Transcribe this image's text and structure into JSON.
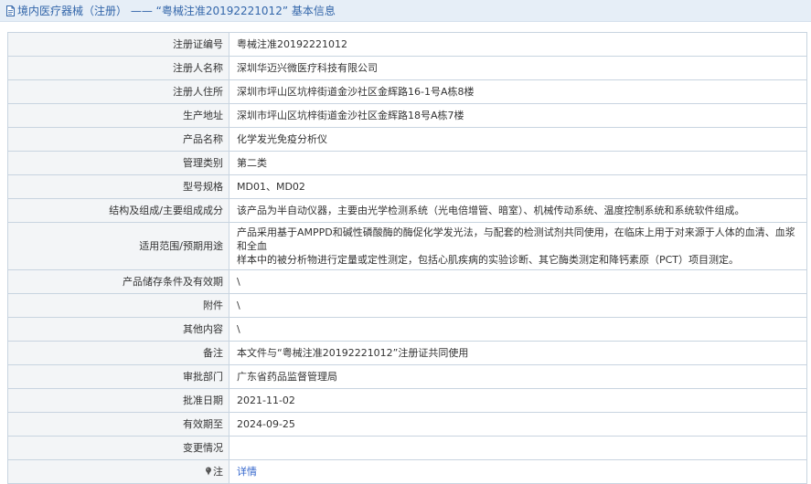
{
  "header": {
    "title": "境内医疗器械（注册） —— “粤械注准20192221012” 基本信息",
    "icon": "document-icon"
  },
  "rows": {
    "reg_no": {
      "label": "注册证编号",
      "value": "粤械注准20192221012"
    },
    "registrant": {
      "label": "注册人名称",
      "value": "深圳华迈兴微医疗科技有限公司"
    },
    "registrant_addr": {
      "label": "注册人住所",
      "value": "深圳市坪山区坑梓街道金沙社区金辉路16-1号A栋8楼"
    },
    "production_addr": {
      "label": "生产地址",
      "value": "深圳市坪山区坑梓街道金沙社区金辉路18号A栋7楼"
    },
    "product_name": {
      "label": "产品名称",
      "value": "化学发光免疫分析仪"
    },
    "category": {
      "label": "管理类别",
      "value": "第二类"
    },
    "model": {
      "label": "型号规格",
      "value": "MD01、MD02"
    },
    "structure": {
      "label": "结构及组成/主要组成成分",
      "value": "该产品为半自动仪器，主要由光学检测系统（光电倍增管、暗室）、机械传动系统、温度控制系统和系统软件组成。"
    },
    "scope": {
      "label": "适用范围/预期用途",
      "value_line1": "产品采用基于AMPPD和碱性磷酸酶的酶促化学发光法，与配套的检测试剂共同使用，在临床上用于对来源于人体的血清、血浆和全血",
      "value_line2": "样本中的被分析物进行定量或定性测定，包括心肌疾病的实验诊断、其它酶类测定和降钙素原（PCT）项目测定。"
    },
    "storage": {
      "label": "产品储存条件及有效期",
      "value": "\\"
    },
    "attachment": {
      "label": "附件",
      "value": "\\"
    },
    "other": {
      "label": "其他内容",
      "value": "\\"
    },
    "remark": {
      "label": "备注",
      "value": "本文件与“粤械注准20192221012”注册证共同使用"
    },
    "authority": {
      "label": "审批部门",
      "value": "广东省药品监督管理局"
    },
    "approval_date": {
      "label": "批准日期",
      "value": "2021-11-02"
    },
    "valid_until": {
      "label": "有效期至",
      "value": "2024-09-25"
    },
    "changes": {
      "label": "变更情况",
      "value": ""
    },
    "note": {
      "label": "注",
      "value": "详情",
      "icon": "pin-icon"
    }
  },
  "colors": {
    "header_bg": "#e6eef7",
    "header_text": "#3366aa",
    "label_bg": "#f3f5f7",
    "border": "#c8d4e0",
    "link": "#3366cc"
  }
}
